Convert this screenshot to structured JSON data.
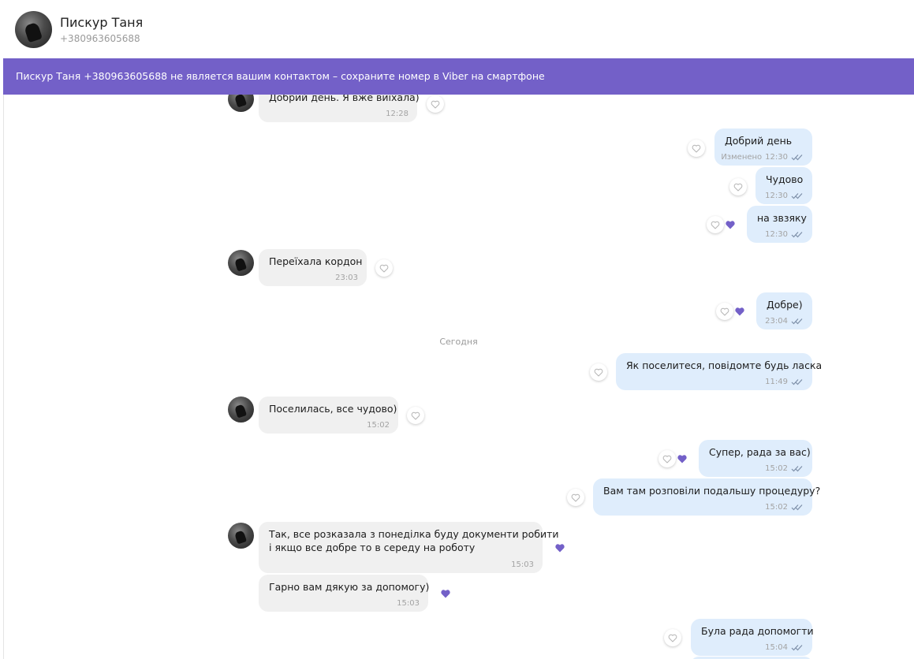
{
  "header": {
    "name": "Пискур Таня",
    "phone": "+380963605688"
  },
  "banner": {
    "text": "Пискур Таня +380963605688 не является вашим контактом – сохраните номер в Viber на смартфоне"
  },
  "colors": {
    "accent": "#7360c8",
    "incoming_bubble": "#f0f0f0",
    "outgoing_bubble": "#dfedfc",
    "tick": "#7d8fa8"
  },
  "date_separator": "Сегодня",
  "messages": [
    {
      "dir": "in",
      "text": "Добрий день. Я вже виїхала)",
      "time": "12:28",
      "edited": ""
    },
    {
      "dir": "out",
      "text": "Добрий день",
      "time": "12:30",
      "edited": "Изменено"
    },
    {
      "dir": "out",
      "text": "Чудово",
      "time": "12:30",
      "edited": ""
    },
    {
      "dir": "out",
      "text": "на звзяку",
      "time": "12:30",
      "edited": ""
    },
    {
      "dir": "in",
      "text": "Переїхала кордон",
      "time": "23:03",
      "edited": ""
    },
    {
      "dir": "out",
      "text": "Добре)",
      "time": "23:04",
      "edited": ""
    },
    {
      "dir": "out",
      "text": "Як поселитеся, повідомте будь ласка",
      "time": "11:49",
      "edited": ""
    },
    {
      "dir": "in",
      "text": "Поселилась, все чудово)",
      "time": "15:02",
      "edited": ""
    },
    {
      "dir": "out",
      "text": "Супер, рада за вас)",
      "time": "15:02",
      "edited": ""
    },
    {
      "dir": "out",
      "text": "Вам там розповіли подальшу процедуру?",
      "time": "15:02",
      "edited": ""
    },
    {
      "dir": "in",
      "text": "Так, все розказала з понеділка буду документи робити",
      "text2": "і якщо все добре то в середу на роботу",
      "time": "15:03",
      "edited": ""
    },
    {
      "dir": "in",
      "text": "Гарно вам дякую за допомогу)",
      "time": "15:03",
      "edited": ""
    },
    {
      "dir": "out",
      "text": "Була рада допомогти",
      "time": "15:04",
      "edited": ""
    }
  ]
}
